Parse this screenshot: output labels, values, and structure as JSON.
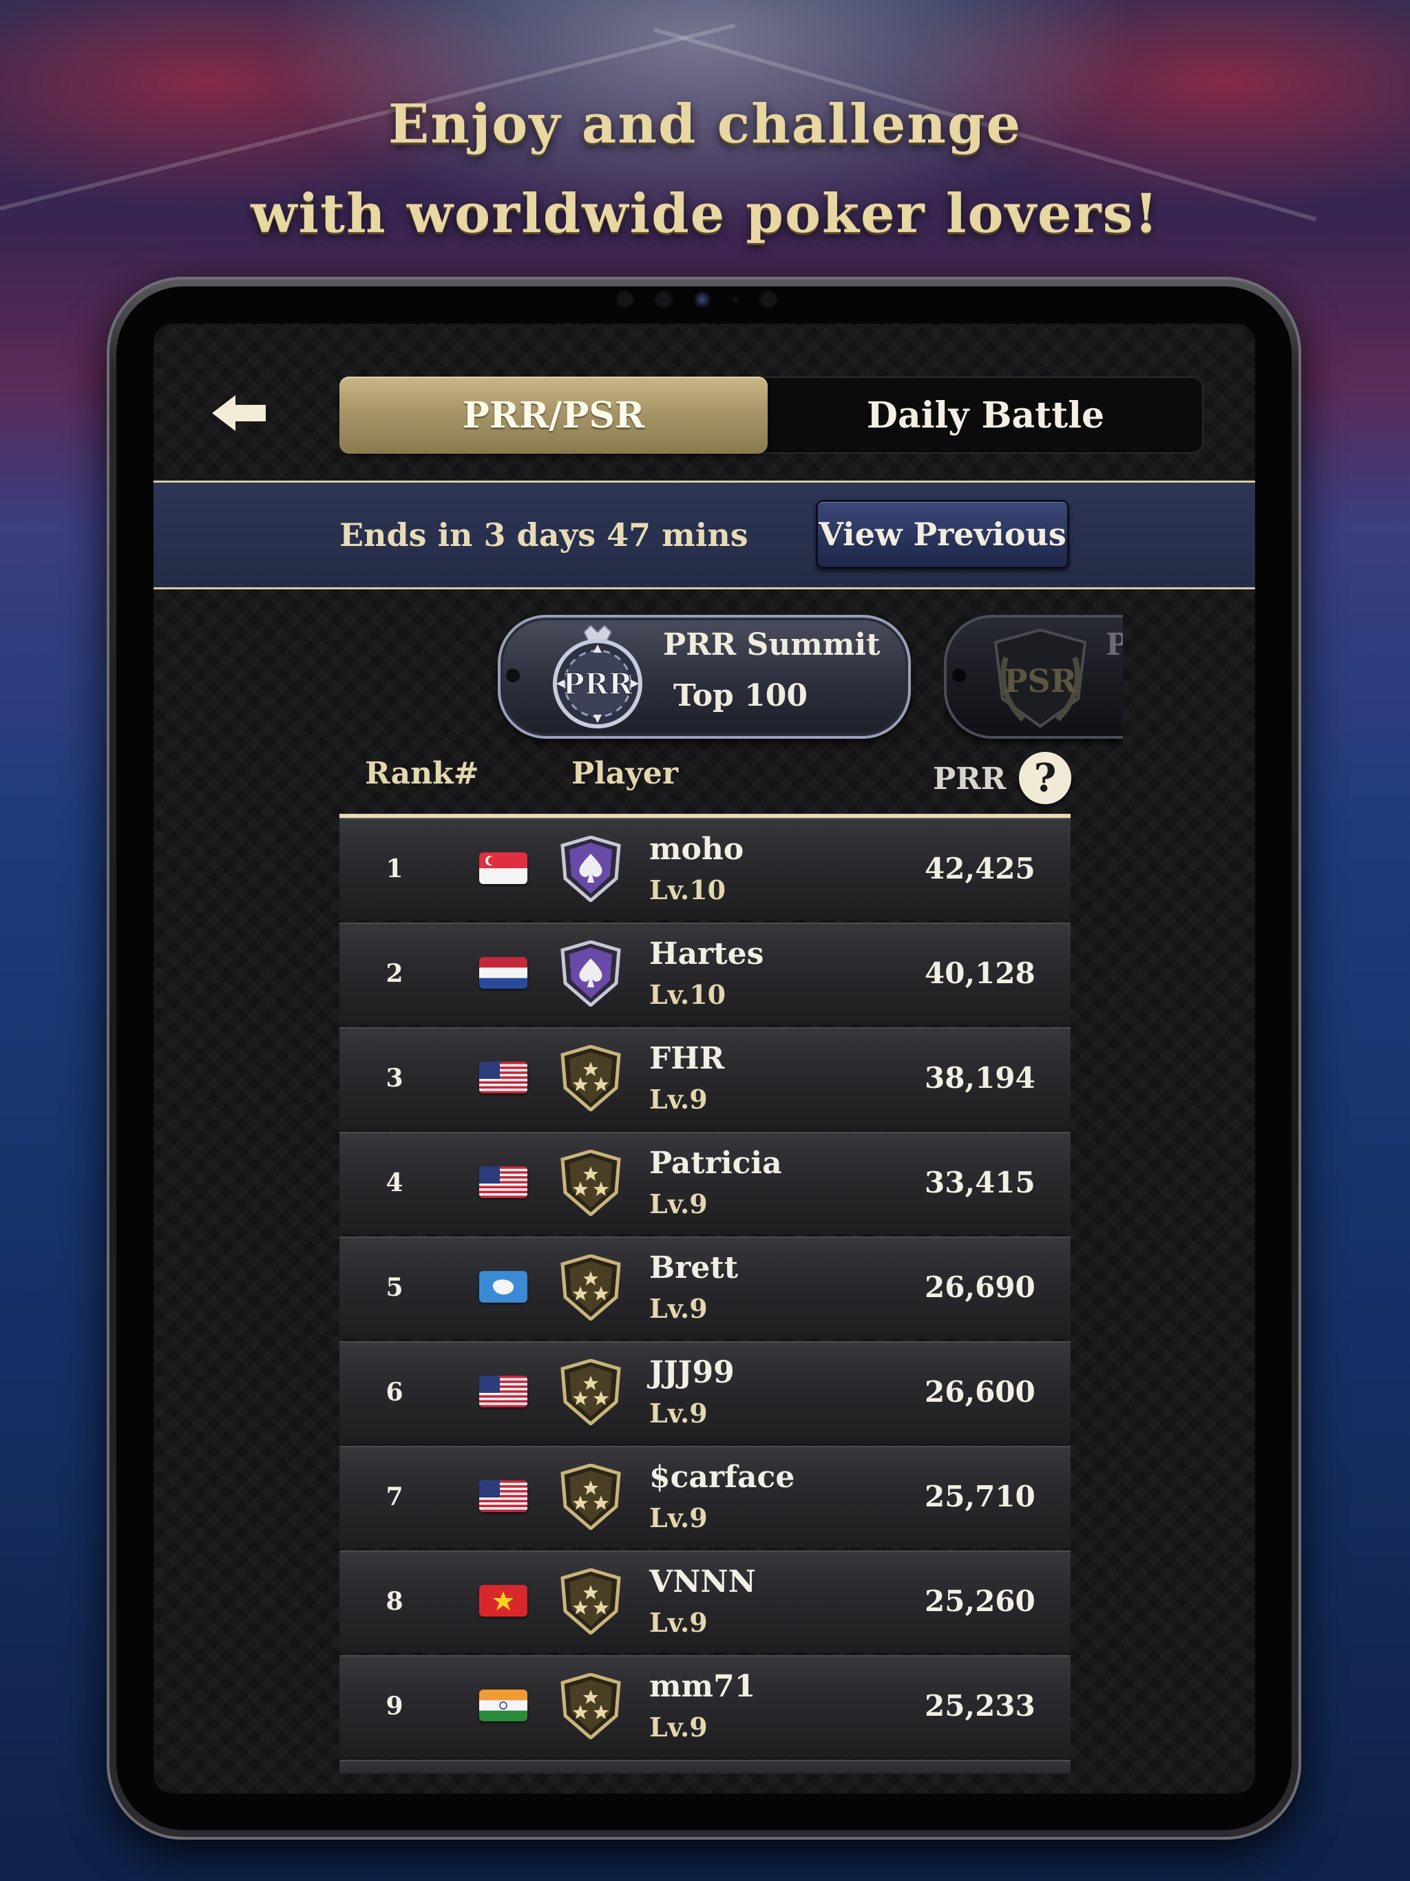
{
  "promo": {
    "line1": "Enjoy and challenge",
    "line2": "with worldwide poker lovers!"
  },
  "tabs": [
    {
      "label": "PRR/PSR",
      "active": true
    },
    {
      "label": "Daily Battle",
      "active": false
    }
  ],
  "countdown": {
    "text": "Ends in 3 days 47 mins",
    "view_previous_label": "View Previous"
  },
  "summits": [
    {
      "badge": "PRR",
      "title": "PRR Summit",
      "subtitle": "Top 100",
      "selected": true
    },
    {
      "badge": "PSR",
      "title": "P",
      "selected": false
    }
  ],
  "table": {
    "headers": {
      "rank": "Rank#",
      "player": "Player",
      "score": "PRR",
      "help": "?"
    },
    "rows": [
      {
        "rank": "1",
        "flag": "SG",
        "badge": "spade-shield",
        "name": "moho",
        "level": "Lv.10",
        "score": "42,425"
      },
      {
        "rank": "2",
        "flag": "NL",
        "badge": "spade-shield",
        "name": "Hartes",
        "level": "Lv.10",
        "score": "40,128"
      },
      {
        "rank": "3",
        "flag": "US",
        "badge": "three-star-shield",
        "name": "FHR",
        "level": "Lv.9",
        "score": "38,194"
      },
      {
        "rank": "4",
        "flag": "US",
        "badge": "three-star-shield",
        "name": "Patricia",
        "level": "Lv.9",
        "score": "33,415"
      },
      {
        "rank": "5",
        "flag": "AQ",
        "badge": "three-star-shield",
        "name": "Brett",
        "level": "Lv.9",
        "score": "26,690"
      },
      {
        "rank": "6",
        "flag": "US",
        "badge": "three-star-shield",
        "name": "JJJ99",
        "level": "Lv.9",
        "score": "26,600"
      },
      {
        "rank": "7",
        "flag": "US",
        "badge": "three-star-shield",
        "name": "$carface",
        "level": "Lv.9",
        "score": "25,710"
      },
      {
        "rank": "8",
        "flag": "VN",
        "badge": "three-star-shield",
        "name": "VNNN",
        "level": "Lv.9",
        "score": "25,260"
      },
      {
        "rank": "9",
        "flag": "IN",
        "badge": "three-star-shield",
        "name": "mm71",
        "level": "Lv.9",
        "score": "25,233"
      }
    ]
  },
  "colors": {
    "accent_gold": "#c9b888",
    "header_text": "#e4d7ad",
    "bar_blue": "#2c3554"
  }
}
